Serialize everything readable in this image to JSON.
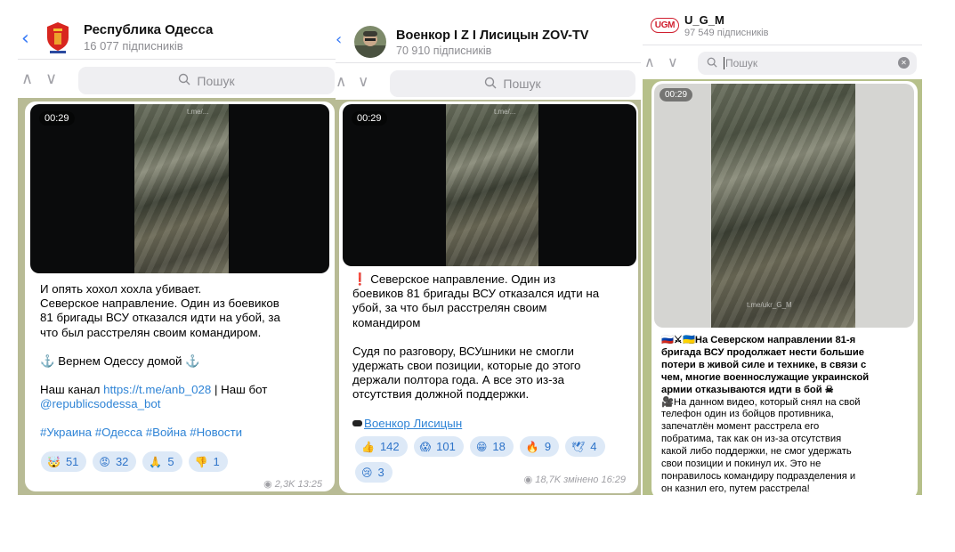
{
  "panels": [
    {
      "back_glyph": "‹",
      "title": "Республика Одесса",
      "subscribers": "16 077 підписників",
      "search_placeholder": "Пошук",
      "nav_up": "∧",
      "nav_down": "∨",
      "video_duration": "00:29",
      "video_watermark": "t.me/...",
      "lines": [
        "И опять хохол хохла убивает.",
        "Северское направление. Один из боевиков",
        "81 бригады ВСУ отказался идти на убой, за",
        "что был расстрелян своим командиром.",
        "⚓ Вернем Одессу домой ⚓",
        "Наш канал ",
        "https://t.me/anb_028",
        " | Наш бот",
        "@republicsodessa_bot",
        "#Украина #Одесса #Война #Новости"
      ],
      "reactions": [
        {
          "emoji": "🤯",
          "count": "51"
        },
        {
          "emoji": "😡",
          "count": "32"
        },
        {
          "emoji": "🙏",
          "count": "5"
        },
        {
          "emoji": "👎",
          "count": "1"
        }
      ],
      "views": "2,3K",
      "time": "13:25"
    },
    {
      "back_glyph": "‹",
      "title": "Военкор I Z I Лисицын ZOV-TV",
      "subscribers": "70 910 підписників",
      "search_placeholder": "Пошук",
      "nav_up": "∧",
      "nav_down": "∨",
      "video_duration": "00:29",
      "video_watermark": "t.me/...",
      "lines": [
        "❗ Северское направление. Один из",
        "боевиков 81 бригады ВСУ отказался идти на",
        "убой, за что был расстрелян своим",
        "командиром",
        "Судя по разговору, ВСУшники не смогли",
        "удержать свои позиции, которые до этого",
        "держали полтора года. А все это из-за",
        "отсутствия должной поддержки.",
        "Военкор Лисицын"
      ],
      "reactions": [
        {
          "emoji": "👍",
          "count": "142"
        },
        {
          "emoji": "😱",
          "count": "101"
        },
        {
          "emoji": "😁",
          "count": "18"
        },
        {
          "emoji": "🔥",
          "count": "9"
        },
        {
          "emoji": "🕊",
          "count": "4"
        },
        {
          "emoji": "😢",
          "count": "3"
        }
      ],
      "views": "18,7K",
      "time": "змінено 16:29"
    },
    {
      "logo_text": "UGM",
      "title": "U_G_M",
      "subscribers": "97 549 підписників",
      "search_placeholder": "Пошук",
      "search_clear": "✕",
      "nav_up": "∧",
      "nav_down": "∨",
      "video_duration": "00:29",
      "video_watermark": "t.me/ukr_G_M",
      "bold_lines": [
        "🇷🇺⚔🇺🇦На Северском направлении 81-я",
        "бригада ВСУ продолжает нести большие",
        "потери в живой силе и технике, в связи с",
        "чем, многие военнослужащие украинской",
        "армии отказываются идти в бой ☠"
      ],
      "lines": [
        "🎥На данном видео, который снял на свой",
        "телефон один из бойцов противника,",
        "запечатлён момент расстрела его",
        "побратима, так как он из-за отсутствия",
        "какой либо поддержки, не смог удержать",
        "свои позиции и покинул их. Это не",
        "понравилось командиру подразделения и",
        "он казнил его, путем расстрела!"
      ]
    }
  ]
}
